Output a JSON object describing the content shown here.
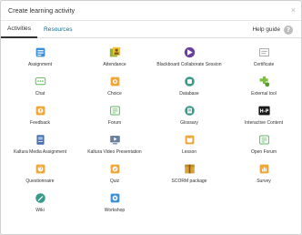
{
  "modal": {
    "title": "Create learning activity",
    "close_glyph": "×"
  },
  "tabs": [
    {
      "label": "Activities",
      "active": true
    },
    {
      "label": "Resources",
      "active": false
    }
  ],
  "help": {
    "label": "Help guide",
    "glyph": "?"
  },
  "activities": [
    {
      "label": "Assignment",
      "icon": "assignment-icon"
    },
    {
      "label": "Attendance",
      "icon": "attendance-icon"
    },
    {
      "label": "Blackboard Collaborate Session",
      "icon": "blackboard-collaborate-icon"
    },
    {
      "label": "Certificate",
      "icon": "certificate-icon"
    },
    {
      "label": "Chat",
      "icon": "chat-icon"
    },
    {
      "label": "Choice",
      "icon": "choice-icon"
    },
    {
      "label": "Database",
      "icon": "database-icon"
    },
    {
      "label": "External tool",
      "icon": "external-tool-icon"
    },
    {
      "label": "Feedback",
      "icon": "feedback-icon"
    },
    {
      "label": "Forum",
      "icon": "forum-icon"
    },
    {
      "label": "Glossary",
      "icon": "glossary-icon"
    },
    {
      "label": "Interactive Content",
      "icon": "h5p-icon",
      "icon_text": "H-P"
    },
    {
      "label": "Kaltura Media Assignment",
      "icon": "kaltura-media-assignment-icon"
    },
    {
      "label": "Kaltura Video Presentation",
      "icon": "kaltura-video-presentation-icon"
    },
    {
      "label": "Lesson",
      "icon": "lesson-icon"
    },
    {
      "label": "Open Forum",
      "icon": "open-forum-icon"
    },
    {
      "label": "Questionnaire",
      "icon": "questionnaire-icon"
    },
    {
      "label": "Quiz",
      "icon": "quiz-icon"
    },
    {
      "label": "SCORM package",
      "icon": "scorm-package-icon"
    },
    {
      "label": "Survey",
      "icon": "survey-icon"
    },
    {
      "label": "Wiki",
      "icon": "wiki-icon"
    },
    {
      "label": "Workshop",
      "icon": "workshop-icon"
    }
  ],
  "colors": {
    "link": "#0f6f8f",
    "orange": "#f0a73a",
    "blue": "#3d8fd6",
    "green": "#5cb85c",
    "purple": "#6a3fa0"
  }
}
